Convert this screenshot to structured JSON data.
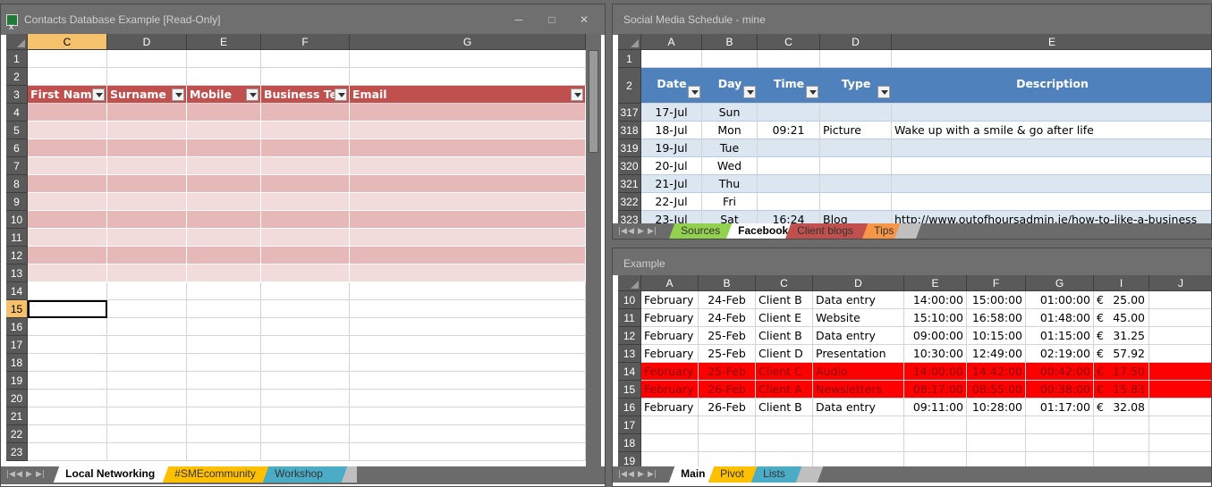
{
  "left": {
    "title": "Contacts Database Example  [Read-Only]",
    "columns": [
      "C",
      "D",
      "E",
      "F",
      "G"
    ],
    "rows": [
      "1",
      "2",
      "3",
      "4",
      "5",
      "6",
      "7",
      "8",
      "9",
      "10",
      "11",
      "12",
      "13",
      "14",
      "15",
      "16",
      "17",
      "18",
      "19",
      "20",
      "21",
      "22",
      "23"
    ],
    "headers": [
      "First Name",
      "Surname",
      "Mobile",
      "Business Tel",
      "Email"
    ],
    "selected_cell_row": "15",
    "tabs": [
      "Local Networking",
      "#SMEcommunity",
      "Workshop"
    ]
  },
  "right_top": {
    "title": "Social Media Schedule - mine",
    "columns": [
      "A",
      "B",
      "C",
      "D",
      "E"
    ],
    "headers": [
      "Date",
      "Day",
      "Time",
      "Type",
      "Description"
    ],
    "row_labels": [
      "1",
      "2",
      "317",
      "318",
      "319",
      "320",
      "321",
      "322",
      "323"
    ],
    "data": [
      [
        "17-Jul",
        "Sun",
        "",
        "",
        ""
      ],
      [
        "18-Jul",
        "Mon",
        "09:21",
        "Picture",
        "Wake up with a smile & go after life"
      ],
      [
        "19-Jul",
        "Tue",
        "",
        "",
        ""
      ],
      [
        "20-Jul",
        "Wed",
        "",
        "",
        ""
      ],
      [
        "21-Jul",
        "Thu",
        "",
        "",
        ""
      ],
      [
        "22-Jul",
        "Fri",
        "",
        "",
        ""
      ],
      [
        "23-Jul",
        "Sat",
        "16:24",
        "Blog",
        "http://www.outofhoursadmin.ie/how-to-like-a-business"
      ]
    ],
    "tabs": [
      "Sources",
      "Facebook",
      "Client blogs",
      "Tips"
    ]
  },
  "right_bottom": {
    "title": "Example",
    "columns": [
      "A",
      "B",
      "C",
      "D",
      "E",
      "F",
      "G",
      "I",
      "J"
    ],
    "row_labels": [
      "10",
      "11",
      "12",
      "13",
      "14",
      "15",
      "16",
      "17",
      "18",
      "19"
    ],
    "data": [
      [
        "February",
        "24-Feb",
        "Client B",
        "Data entry",
        "14:00:00",
        "15:00:00",
        "01:00:00",
        "€",
        "25.00"
      ],
      [
        "February",
        "24-Feb",
        "Client E",
        "Website",
        "15:10:00",
        "16:58:00",
        "01:48:00",
        "€",
        "45.00"
      ],
      [
        "February",
        "25-Feb",
        "Client B",
        "Data entry",
        "09:00:00",
        "10:15:00",
        "01:15:00",
        "€",
        "31.25"
      ],
      [
        "February",
        "25-Feb",
        "Client D",
        "Presentation",
        "10:30:00",
        "12:49:00",
        "02:19:00",
        "€",
        "57.92"
      ],
      [
        "February",
        "25-Feb",
        "Client C",
        "Audio",
        "14:00:00",
        "14:42:00",
        "00:42:00",
        "€",
        "17.50"
      ],
      [
        "February",
        "26-Feb",
        "Client A",
        "Newsletters",
        "08:17:00",
        "08:55:00",
        "00:38:00",
        "€",
        "15.83"
      ],
      [
        "February",
        "26-Feb",
        "Client B",
        "Data entry",
        "09:11:00",
        "10:28:00",
        "01:17:00",
        "€",
        "32.08"
      ]
    ],
    "highlight_rows": [
      4,
      5
    ],
    "highlight_color": "#ff0000",
    "tabs": [
      "Main",
      "Pivot",
      "Lists"
    ]
  },
  "colors": {
    "table_header_red": "#c0504d",
    "band_dark": "#e6b8b7",
    "band_light": "#f2dcdb",
    "table_header_blue": "#4f81bd",
    "band_blue": "#dce6f1",
    "selected_header": "#f5c26b"
  }
}
